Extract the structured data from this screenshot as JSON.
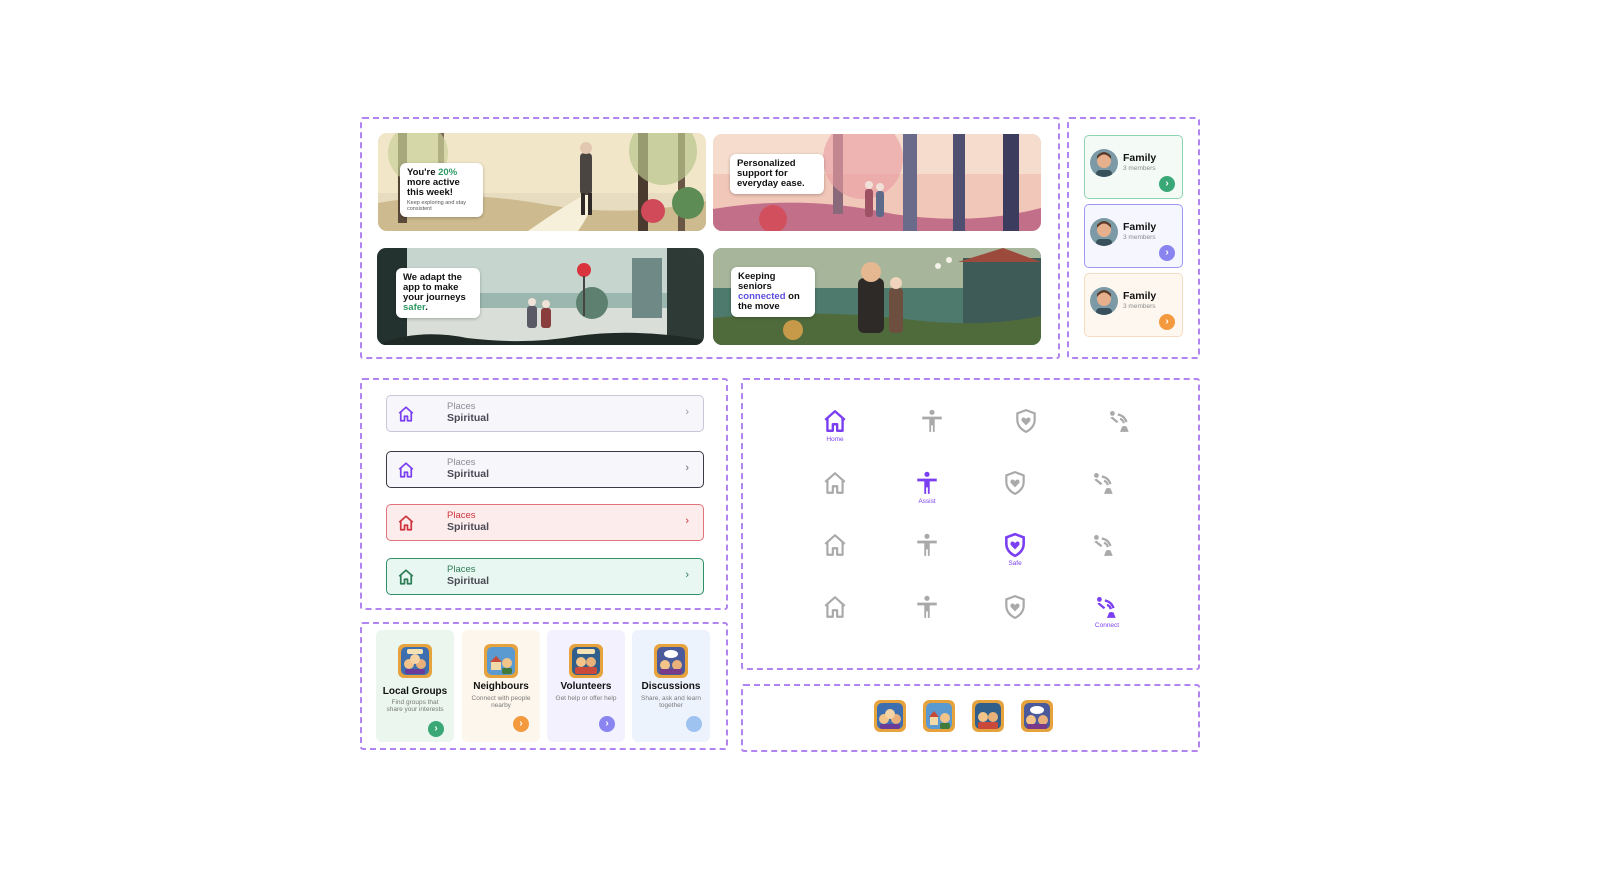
{
  "banners": [
    {
      "pre": "You're ",
      "highlight": "20%",
      "post": " more active this week!",
      "sub": "Keep exploring and stay consistent"
    },
    {
      "text": "Personalized support for everyday ease."
    },
    {
      "pre": "We adapt the app to make your journeys ",
      "highlight": "safer",
      "post": "."
    },
    {
      "pre": "Keeping seniors ",
      "highlight": "connected",
      "post": " on the move"
    }
  ],
  "family_cards": [
    {
      "name": "Family",
      "members": "3 members",
      "accent": "#3aa876"
    },
    {
      "name": "Family",
      "members": "3 members",
      "accent": "#8a84f0"
    },
    {
      "name": "Family",
      "members": "3 members",
      "accent": "#f39a3e"
    }
  ],
  "places": [
    {
      "label": "Places",
      "value": "Spiritual",
      "state": "default"
    },
    {
      "label": "Places",
      "value": "Spiritual",
      "state": "focused"
    },
    {
      "label": "Places",
      "value": "Spiritual",
      "state": "error"
    },
    {
      "label": "Places",
      "value": "Spiritual",
      "state": "success"
    }
  ],
  "categories": [
    {
      "title": "Local Groups",
      "desc": "Find groups that share your interests",
      "icon": "local-groups-icon"
    },
    {
      "title": "Neighbours",
      "desc": "Connect with people nearby",
      "icon": "neighbours-icon"
    },
    {
      "title": "Volunteers",
      "desc": "Get help or offer help",
      "icon": "volunteers-icon"
    },
    {
      "title": "Discussions",
      "desc": "Share, ask and learn together",
      "icon": "discussions-icon"
    }
  ],
  "nav_labels": {
    "home": "Home",
    "assist": "Assist",
    "safe": "Safe",
    "connect": "Connect"
  },
  "colors": {
    "frame": "#b184f0",
    "active": "#7b3ff2",
    "inactive": "#a9a9a9"
  }
}
